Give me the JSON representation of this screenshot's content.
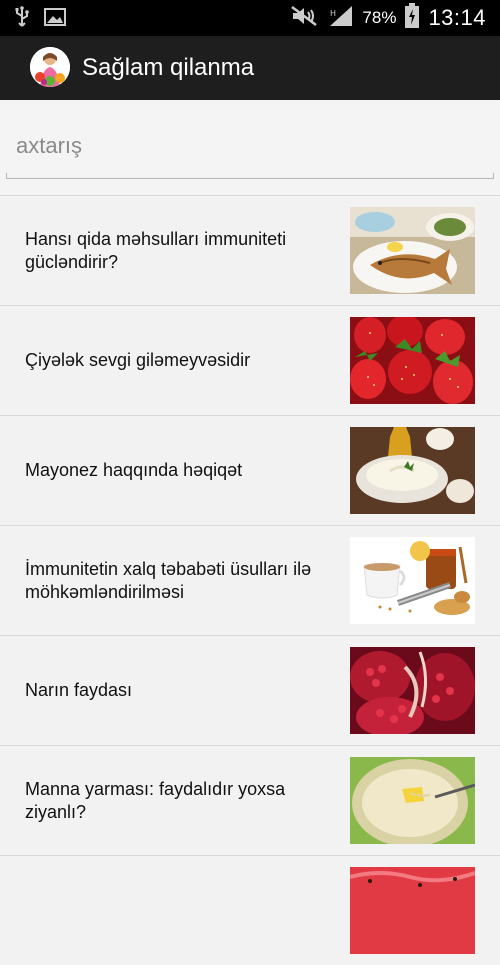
{
  "status_bar": {
    "battery_percent": "78%",
    "time": "13:14",
    "icons": [
      "usb-icon",
      "image-icon",
      "mute-icon",
      "signal-icon",
      "battery-icon"
    ]
  },
  "action_bar": {
    "title": "Sağlam qilanma",
    "icon": "app-logo-icon"
  },
  "search": {
    "placeholder": "axtarış"
  },
  "articles": [
    {
      "title": "Hansı qida məhsulları immuniteti gücləndirir?",
      "image": "fish-meal-image"
    },
    {
      "title": "Çiyələk sevgi giləmeyvəsidir",
      "image": "strawberries-image"
    },
    {
      "title": "Mayonez haqqında həqiqət",
      "image": "mayonnaise-image"
    },
    {
      "title": "İmmunitetin xalq təbabəti üsulları ilə möhkəmləndirilməsi",
      "image": "tea-honey-ginger-image"
    },
    {
      "title": "Narın faydası",
      "image": "pomegranate-image"
    },
    {
      "title": "Manna yarması: faydalıdır yoxsa ziyanlı?",
      "image": "semolina-porridge-image"
    },
    {
      "title": "",
      "image": "watermelon-image"
    }
  ],
  "colors": {
    "status_bar": "#000000",
    "action_bar": "#1e1e1e",
    "background": "#f2f2f2",
    "divider": "#d9d9d9"
  }
}
